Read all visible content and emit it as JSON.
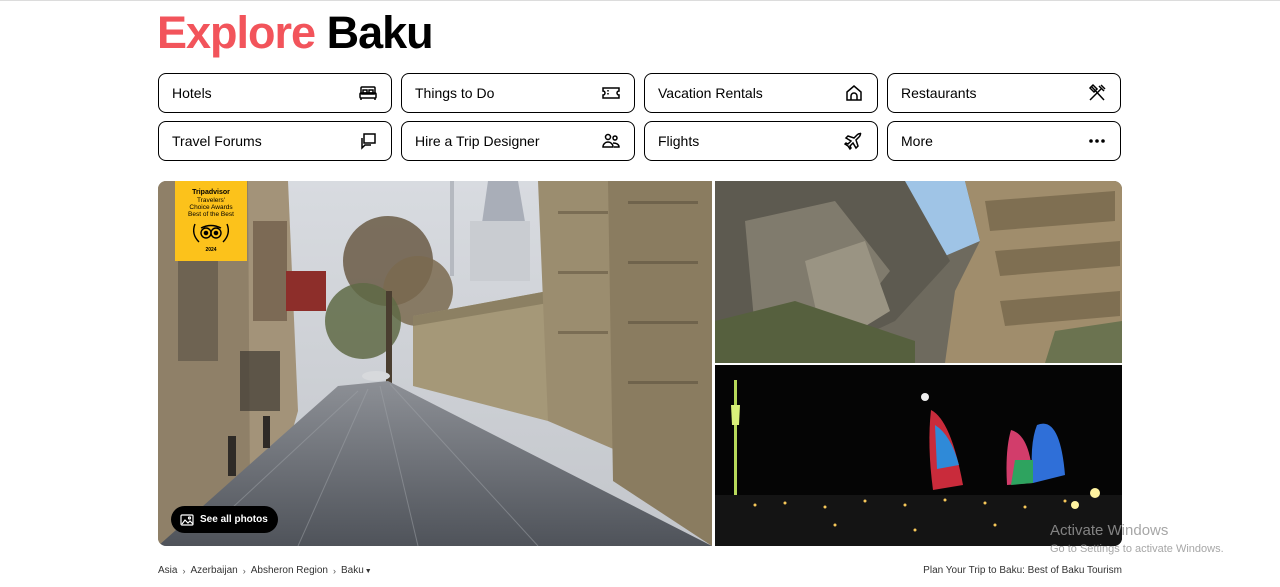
{
  "header": {
    "title_part1": "Explore",
    "title_part2": "Baku"
  },
  "nav": {
    "row1": [
      {
        "label": "Hotels",
        "icon": "bed-icon"
      },
      {
        "label": "Things to Do",
        "icon": "ticket-icon"
      },
      {
        "label": "Vacation Rentals",
        "icon": "house-icon"
      },
      {
        "label": "Restaurants",
        "icon": "fork-knife-icon"
      }
    ],
    "row2": [
      {
        "label": "Travel Forums",
        "icon": "chat-bubbles-icon"
      },
      {
        "label": "Hire a Trip Designer",
        "icon": "people-icon"
      },
      {
        "label": "Flights",
        "icon": "plane-icon"
      },
      {
        "label": "More",
        "icon": "more-dots-icon"
      }
    ]
  },
  "gallery": {
    "award": {
      "brand": "Tripadvisor",
      "line1": "Travelers'",
      "line2": "Choice Awards",
      "line3": "Best of the Best",
      "year": "2024",
      "color": "#fcc21b"
    },
    "see_all_label": "See all photos"
  },
  "breadcrumbs": {
    "items": [
      "Asia",
      "Azerbaijan",
      "Absheron Region",
      "Baku"
    ],
    "separator": "›"
  },
  "plan_link": "Plan Your Trip to Baku: Best of Baku Tourism",
  "watermark": {
    "line1": "Activate Windows",
    "line2": "Go to Settings to activate Windows."
  },
  "colors": {
    "brand_red": "#f2545b",
    "text": "#000000"
  }
}
